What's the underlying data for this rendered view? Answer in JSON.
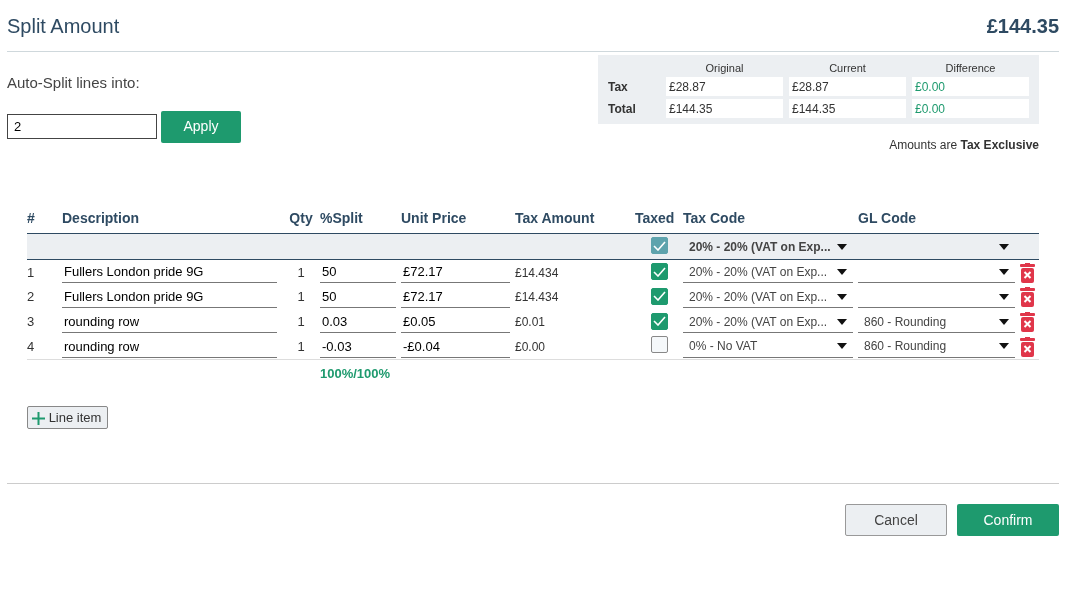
{
  "title": "Split Amount",
  "total": "£144.35",
  "auto_split": {
    "label": "Auto-Split lines into:",
    "value": "2",
    "button": "Apply"
  },
  "summary": {
    "columns": [
      "Original",
      "Current",
      "Difference"
    ],
    "rows": [
      {
        "label": "Tax",
        "original": "£28.87",
        "current": "£28.87",
        "difference": "£0.00"
      },
      {
        "label": "Total",
        "original": "£144.35",
        "current": "£144.35",
        "difference": "£0.00"
      }
    ],
    "note": "Amounts are **Tax Exclusive**"
  },
  "table": {
    "columns": [
      "#",
      "Description",
      "Qty",
      "%Split",
      "Unit Price",
      "Tax Amount",
      "Taxed",
      "Tax Code",
      "GL Code"
    ],
    "bulk": {
      "taxed": true,
      "tax_code": "20% - 20% (VAT on Exp..."
    },
    "rows": [
      {
        "num": "1",
        "description": "Fullers London pride 9G",
        "qty": "1",
        "split": "50",
        "unit_price": "£72.17",
        "tax_amount": "£14.434",
        "taxed": true,
        "tax_code": "20% - 20% (VAT on Exp...",
        "gl_code": ""
      },
      {
        "num": "2",
        "description": "Fullers London pride 9G",
        "qty": "1",
        "split": "50",
        "unit_price": "£72.17",
        "tax_amount": "£14.434",
        "taxed": true,
        "tax_code": "20% - 20% (VAT on Exp...",
        "gl_code": ""
      },
      {
        "num": "3",
        "description": "rounding row",
        "qty": "1",
        "split": "0.03",
        "unit_price": "£0.05",
        "tax_amount": "£0.01",
        "taxed": true,
        "tax_code": "20% - 20% (VAT on Exp...",
        "gl_code": "860 - Rounding"
      },
      {
        "num": "4",
        "description": "rounding row",
        "qty": "1",
        "split": "-0.03",
        "unit_price": "-£0.04",
        "tax_amount": "£0.00",
        "taxed": false,
        "tax_code": "0% - No VAT",
        "gl_code": "860 - Rounding"
      }
    ],
    "split_total": "100%/100%"
  },
  "add_button": "Line item",
  "buttons": {
    "cancel": "Cancel",
    "confirm": "Confirm"
  }
}
